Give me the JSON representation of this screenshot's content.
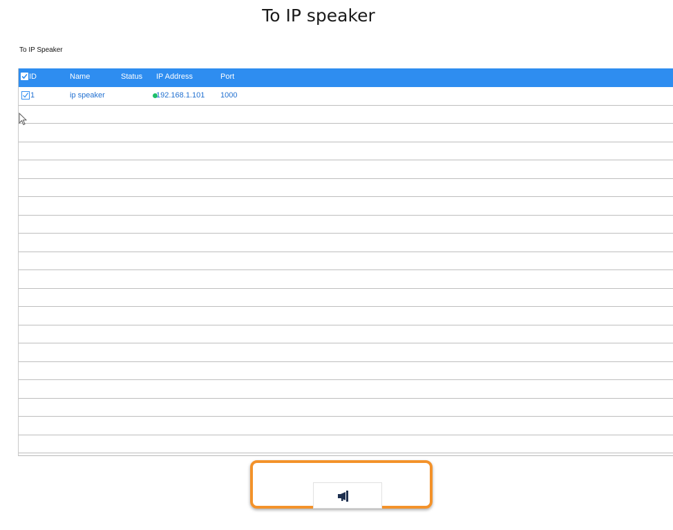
{
  "page_title": "To IP speaker",
  "section_label": "To IP Speaker",
  "table": {
    "columns": [
      "ID",
      "Name",
      "Status",
      "IP Address",
      "Port"
    ],
    "rows": [
      {
        "id": "1",
        "name": "ip speaker",
        "status": "online",
        "ip": "192.168.1.101",
        "port": "1000",
        "checked": true
      }
    ]
  },
  "icons": {
    "talk_button": "megaphone-icon",
    "status": "status-dot-icon",
    "cursor": "mouse-cursor-icon"
  },
  "colors": {
    "header_bg": "#2e8df0",
    "row_text": "#1f6fd0",
    "status_online": "#1fbf6a",
    "highlight": "#f3922a"
  }
}
